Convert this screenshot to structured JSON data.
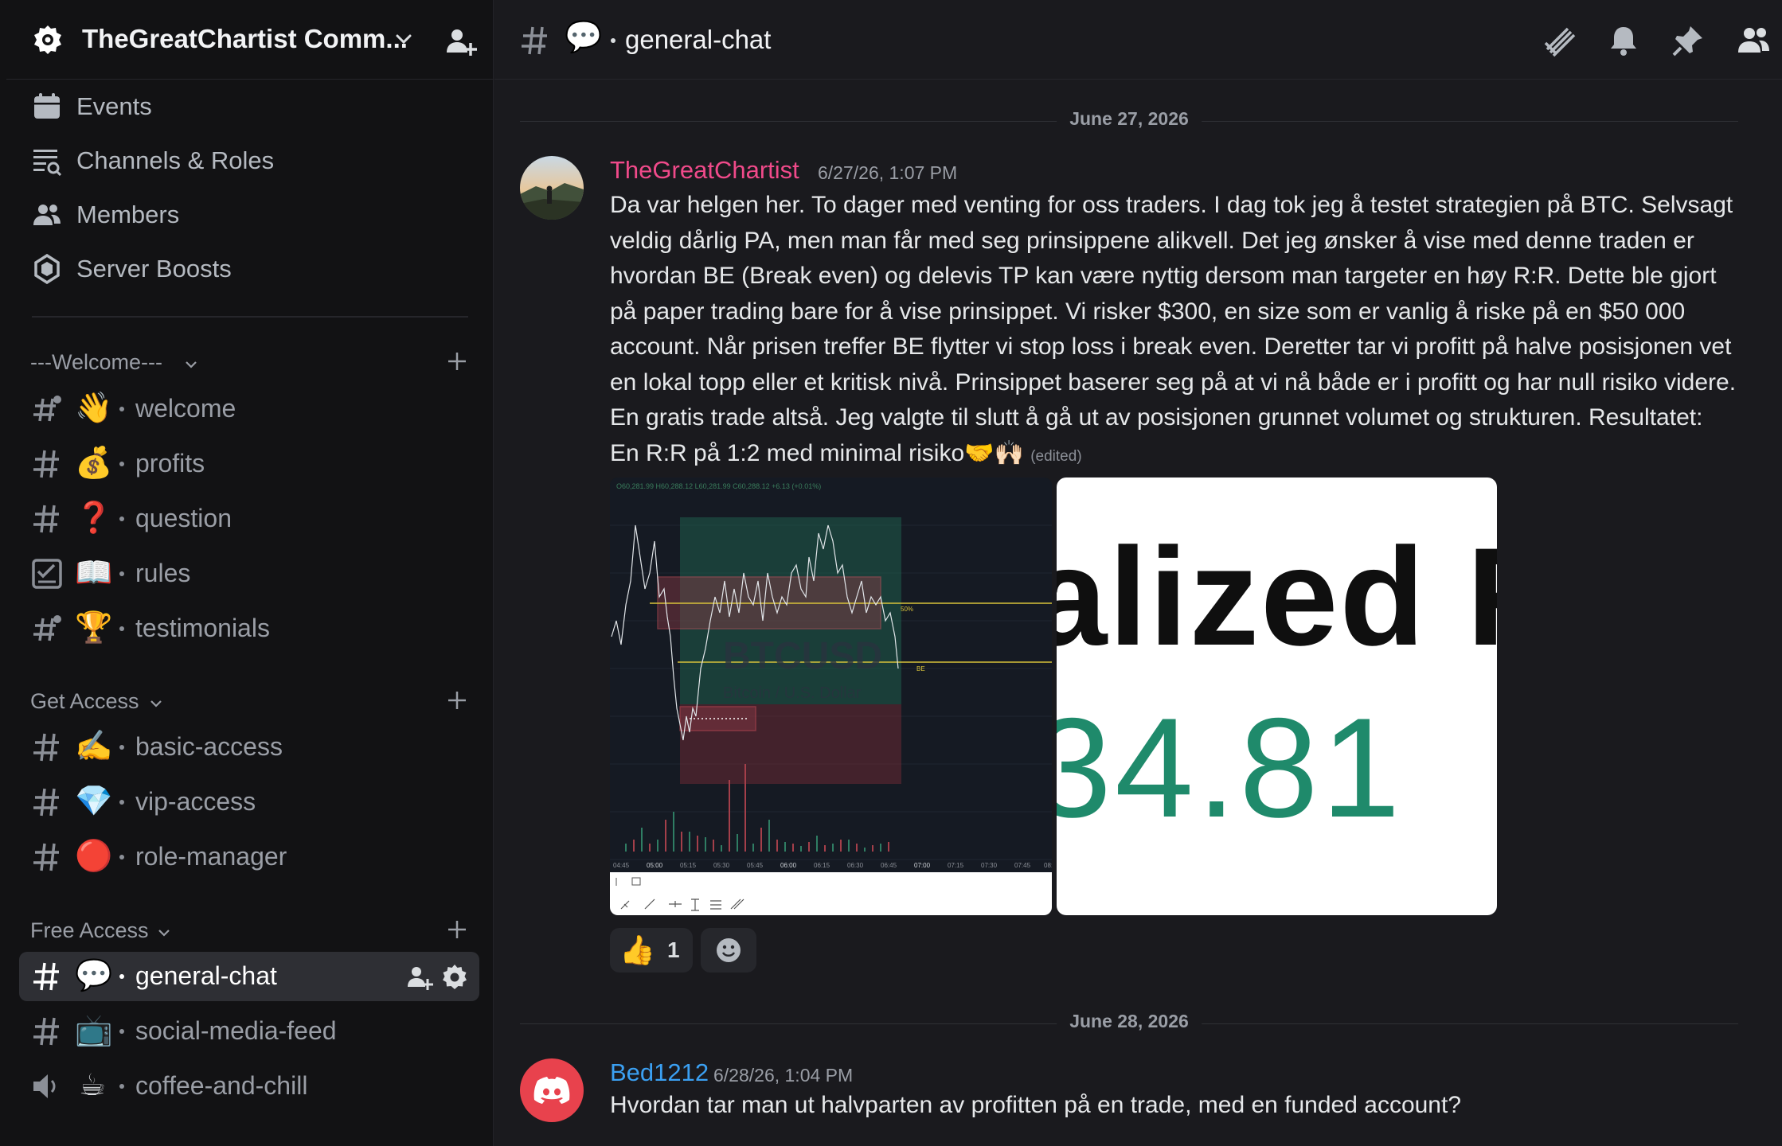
{
  "server": {
    "name": "TheGreatChartist Comm...",
    "icon": "gear-badge-icon"
  },
  "tools": [
    {
      "label": "Events",
      "icon": "calendar-icon"
    },
    {
      "label": "Channels & Roles",
      "icon": "channels-roles-icon"
    },
    {
      "label": "Members",
      "icon": "members-icon"
    },
    {
      "label": "Server Boosts",
      "icon": "boost-gem-icon"
    }
  ],
  "categories": [
    {
      "label": "---Welcome---",
      "channels": [
        {
          "name": "welcome",
          "emoji": "👋",
          "icon": "hash-rules-icon"
        },
        {
          "name": "profits",
          "emoji": "💰",
          "icon": "hash-icon"
        },
        {
          "name": "question",
          "emoji": "❓",
          "icon": "hash-icon"
        },
        {
          "name": "rules",
          "emoji": "📖",
          "icon": "rules-checkbox-icon"
        },
        {
          "name": "testimonials",
          "emoji": "🏆",
          "icon": "hash-rules-icon"
        }
      ]
    },
    {
      "label": "Get Access",
      "channels": [
        {
          "name": "basic-access",
          "emoji": "✍️",
          "icon": "hash-icon"
        },
        {
          "name": "vip-access",
          "emoji": "💎",
          "icon": "hash-icon"
        },
        {
          "name": "role-manager",
          "emoji": "🔴",
          "icon": "hash-icon"
        }
      ]
    },
    {
      "label": "Free Access",
      "channels": [
        {
          "name": "general-chat",
          "emoji": "💬",
          "icon": "hash-icon",
          "active": true
        },
        {
          "name": "social-media-feed",
          "emoji": "📺",
          "icon": "hash-icon"
        },
        {
          "name": "coffee-and-chill",
          "emoji": "☕",
          "icon": "speaker-icon"
        }
      ]
    }
  ],
  "header": {
    "channel_emoji": "💬",
    "channel_name": "general-chat",
    "icons": [
      "threads-icon",
      "bell-icon",
      "pin-icon",
      "member-list-icon"
    ]
  },
  "messages": [
    {
      "date_separator": "June 27, 2026",
      "author": "TheGreatChartist",
      "author_color": "#f04a8a",
      "timestamp": "6/27/26, 1:07 PM",
      "body": "Da var helgen her. To dager med venting for oss traders. I dag tok jeg å testet strategien på BTC. Selvsagt veldig dårlig PA, men man får med seg prinsippene alikvell. Det jeg ønsker å vise med denne traden er hvordan BE (Break even) og delevis TP kan være nyttig dersom man targeter en høy R:R. Dette ble gjort på paper trading bare for å vise prinsippet. Vi risker $300, en size som er vanlig å riske på en $50 000 account. Når prisen treffer BE flytter vi stop loss i break even. Deretter tar vi profitt på halve posisjonen vet en lokal topp eller et kritisk nivå. Prinsippet baserer seg på at vi nå både er i profitt og har null risiko videre. En gratis trade altså. Jeg valgte til slutt å gå ut av posisjonen grunnet volumet og strukturen. Resultatet: En R:R på 1:2 med minimal risiko",
      "body_emojis": "🤝🙌🏻",
      "edited_label": "(edited)",
      "attachments": {
        "chart": {
          "ohlc_line": "O60,281.99 H60,288.12 L60,281.99 C60,288.12 +6.13 (+0.01%)",
          "watermark_symbol": "BTCUSD",
          "watermark_name": "Bitcoin / U.S. Dollar",
          "level_50": "50%",
          "level_be": "BE",
          "time_ticks": [
            "04:45",
            "05:00",
            "05:15",
            "05:30",
            "05:45",
            "06:00",
            "06:15",
            "06:30",
            "06:45",
            "07:00",
            "07:15",
            "07:30",
            "07:45",
            "08:"
          ]
        },
        "zoom": {
          "text": "alized R",
          "number": "34.81"
        }
      },
      "reactions": [
        {
          "emoji": "👍",
          "count": "1"
        }
      ]
    },
    {
      "date_separator": "June 28, 2026",
      "author": "Bed1212",
      "author_color": "#3ba0f2",
      "timestamp": "6/28/26, 1:04 PM",
      "body": "Hvordan tar man ut halvparten av profitten på en trade, med en funded account?"
    }
  ]
}
